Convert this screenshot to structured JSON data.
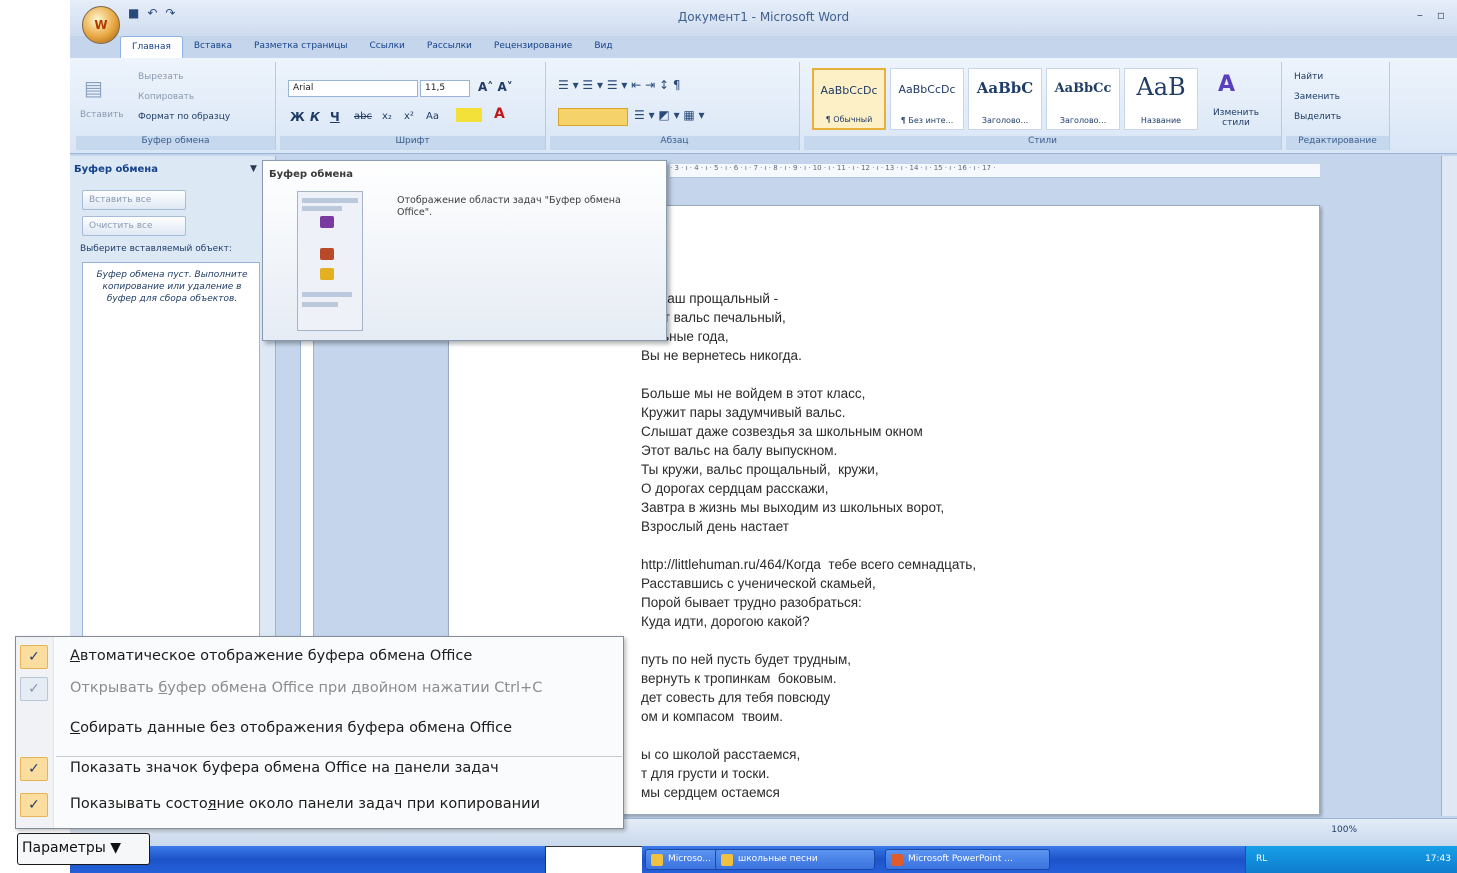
{
  "window": {
    "title": "Документ1 - Microsoft Word",
    "office_button_label": "W",
    "qat_icons": [
      "save-icon",
      "undo-icon",
      "redo-icon"
    ],
    "controls": [
      "–",
      "▫",
      "✕"
    ]
  },
  "tabs": [
    "Главная",
    "Вставка",
    "Разметка страницы",
    "Ссылки",
    "Рассылки",
    "Рецензирование",
    "Вид"
  ],
  "ribbon": {
    "clipboard": {
      "paste": "Вставить",
      "cut": "Вырезать",
      "copy": "Копировать",
      "format_painter": "Формат по образцу",
      "label": "Буфер обмена"
    },
    "font": {
      "name": "Arial",
      "size": "11,5",
      "label": "Шрифт",
      "buttons": [
        "Ж",
        "К",
        "Ч",
        "abc",
        "x₂",
        "x²",
        "Aa"
      ]
    },
    "paragraph": {
      "label": "Абзац"
    },
    "styles": {
      "label": "Стили",
      "items": [
        {
          "sample": "AaBbCcDc",
          "name": "¶ Обычный"
        },
        {
          "sample": "AaBbCcDc",
          "name": "¶ Без инте..."
        },
        {
          "sample": "AaBbC",
          "name": "Заголово..."
        },
        {
          "sample": "AaBbCc",
          "name": "Заголово..."
        },
        {
          "sample": "AaB",
          "name": "Название"
        }
      ],
      "change_styles": "Изменить стили"
    },
    "editing": {
      "label": "Редактирование",
      "find": "Найти",
      "replace": "Заменить",
      "select": "Выделить"
    }
  },
  "task_pane": {
    "title": "Буфер обмена",
    "paste_all": "Вставить все",
    "clear_all": "Очистить все",
    "hint": "Выберите вставляемый объект:",
    "empty_text": "Буфер обмена пуст. Выполните копирование или удаление в буфер для сбора объектов."
  },
  "tooltip": {
    "title": "Буфер обмена",
    "description": "Отображение области задач \"Буфер обмена Office\"."
  },
  "document": {
    "lines": [
      "ер наш прощальный -",
      "одит вальс печальный,",
      "кольные года,",
      "Вы не вернетесь никогда.",
      "",
      "Больше мы не войдем в этот класс,",
      "Кружит пары задумчивый вальс.",
      "Слышат даже созвездья за школьным окном",
      "Этот вальс на балу выпускном.",
      "Ты кружи, вальс прощальный,  кружи,",
      "О дорогах сердцам расскажи,",
      "Завтра в жизнь мы выходим из школьных ворот,",
      "Взрослый день настает",
      "",
      "http://littlehuman.ru/464/Когда  тебе всего семнадцать,",
      "Расставшись с ученической скамьей,",
      "Порой бывает трудно разобраться:",
      "Куда идти, дорогою какой?",
      "",
      "путь по ней пусть будет трудным,",
      "вернуть к тропинкам  боковым.",
      "дет совесть для тебя повсюду",
      "ом и компасом  твоим.",
      "",
      "ы со школой расстаемся,",
      "т для грусти и тоски.",
      "мы сердцем остаемся"
    ]
  },
  "status_bar": {
    "zoom": "100%"
  },
  "taskbar": {
    "items": [
      "Microso...",
      "школьные песни",
      "Microsoft PowerPoint ..."
    ],
    "lang": "RL",
    "clock": "17:43"
  },
  "options_menu": {
    "items": [
      {
        "pre": "",
        "u": "А",
        "post": "втоматическое отображение буфера обмена Office",
        "checked": true,
        "disabled": false
      },
      {
        "pre": "Открывать ",
        "u": "б",
        "post": "уфер обмена Office при двойном нажатии Ctrl+C",
        "checked": true,
        "disabled": true
      },
      {
        "pre": "",
        "u": "С",
        "post": "обирать данные без отображения буфера обмена Office",
        "checked": false,
        "disabled": false
      },
      {
        "pre": "Показать значок буфера обмена Office на ",
        "u": "п",
        "post": "анели задач",
        "checked": true,
        "disabled": false
      },
      {
        "pre": "Показывать состо",
        "u": "я",
        "post": "ние около панели задач при копировании",
        "checked": true,
        "disabled": false
      }
    ],
    "button_label": "Параметры ▼"
  }
}
